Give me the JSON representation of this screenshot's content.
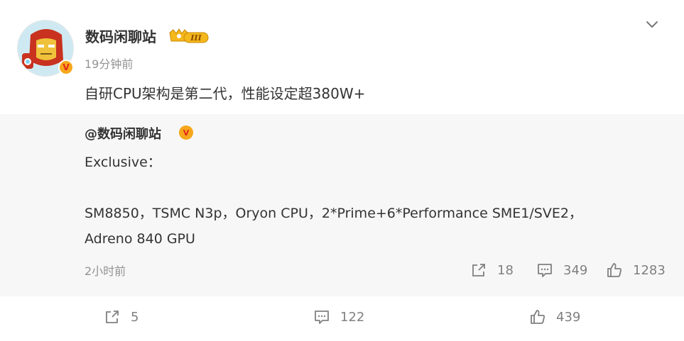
{
  "post": {
    "author": "数码闲聊站",
    "timestamp": "19分钟前",
    "text": "自研CPU架构是第二代，性能设定超380W+",
    "verified_mark": "V",
    "level_badge": "III"
  },
  "repost": {
    "author": "@数码闲聊站",
    "verified_mark": "V",
    "lines": [
      "Exclusive：",
      "",
      "SM8850，TSMC N3p，Oryon CPU，2*Prime+6*Performance SME1/SVE2，",
      "Adreno 840 GPU"
    ],
    "timestamp": "2小时前",
    "shares": "18",
    "comments": "349",
    "likes": "1283"
  },
  "footer": {
    "shares": "5",
    "comments": "122",
    "likes": "439"
  },
  "icons": {
    "collapse": "chevron-down-icon",
    "share": "share-icon",
    "comment": "comment-icon",
    "like": "like-icon"
  },
  "colors": {
    "repost_background": "#f7f7f7",
    "muted_text": "#939393",
    "verified_badge": "#f7a71b"
  }
}
